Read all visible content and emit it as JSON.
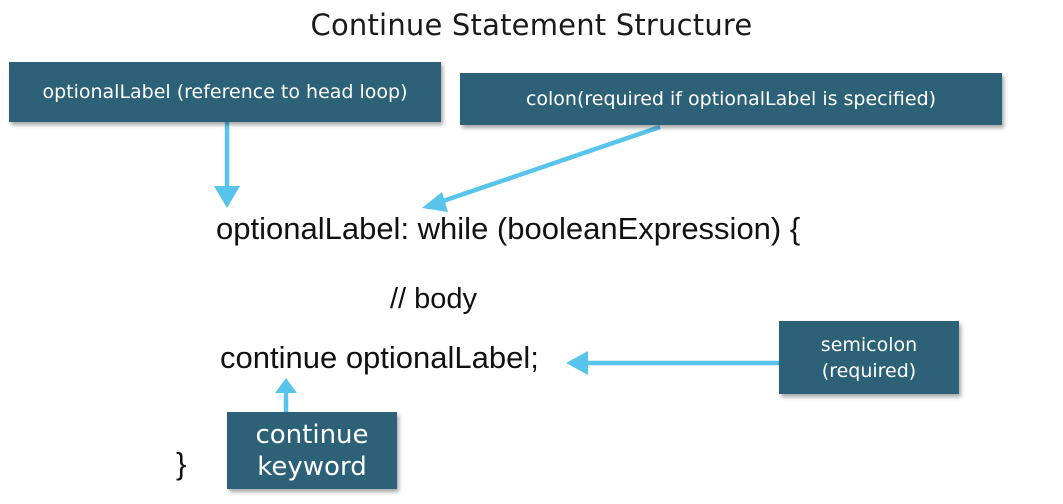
{
  "title": "Continue Statement Structure",
  "callouts": {
    "optional_label": "optionalLabel (reference to head loop)",
    "colon": "colon(required if optionalLabel is specified)",
    "semicolon_line1": "semicolon",
    "semicolon_line2": "(required)",
    "keyword_line1": "continue",
    "keyword_line2": "keyword"
  },
  "code": {
    "while_line": "optionalLabel: while (booleanExpression) {",
    "body_line": "// body",
    "continue_line": "continue optionalLabel;",
    "closing_brace": "}"
  },
  "colors": {
    "callout_background": "#2d6178",
    "arrow": "#58c4ec",
    "text": "#111111"
  }
}
